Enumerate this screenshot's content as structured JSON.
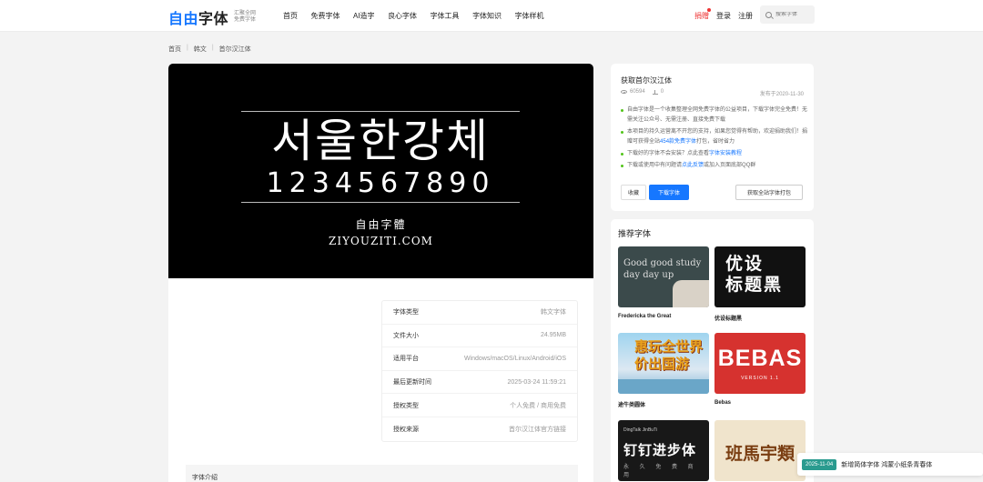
{
  "header": {
    "logo_main_a": "自由",
    "logo_main_b": "字体",
    "logo_sub_1": "汇聚全网",
    "logo_sub_2": "免费字体",
    "nav": [
      "首页",
      "免费字体",
      "AI造字",
      "良心字体",
      "字体工具",
      "字体知识",
      "字体样机"
    ],
    "donate": "捐赠",
    "login": "登录",
    "register": "注册",
    "search_placeholder": "搜索字体"
  },
  "breadcrumb": [
    "首页",
    "韩文",
    "首尔汉江体"
  ],
  "preview": {
    "korean": "서울한강체",
    "numbers": "1234567890",
    "brand_cn": "自由字體",
    "brand_en": "ZIYOUZITI.COM"
  },
  "info_rows": [
    {
      "key": "字体类型",
      "value": "韩文字体"
    },
    {
      "key": "文件大小",
      "value": "24.95MB"
    },
    {
      "key": "适用平台",
      "value": "Windows/macOS/Linux/Android/iOS"
    },
    {
      "key": "最后更新时间",
      "value": "2025-03-24 11:59:21"
    },
    {
      "key": "授权类型",
      "value": "个人免费 / 商用免费"
    },
    {
      "key": "授权来源",
      "value": "首尔汉江体官方链接"
    }
  ],
  "intro_label": "字体介绍",
  "get_card": {
    "title": "获取首尔汉江体",
    "views": "60594",
    "downloads": "0",
    "published": "发布于2020-11-30",
    "tips": [
      {
        "a": "自由字体是一个收集整理全网免费字体的公益项目，下载字体完全免费！无需关注公众号、无需注册、直接免费下载",
        "b": "",
        "c": ""
      },
      {
        "a": "本项目的持久运营离不开您的支持，如果您觉得有帮助，欢迎捐助我们！捐赠可获得全站",
        "b": "454款免费字体",
        "c": "打包，省时省力"
      },
      {
        "a": "下载好的字体不会安装？点此查看",
        "b": "字体安装教程",
        "c": ""
      },
      {
        "a": "下载或使用中有问题请",
        "b": "点此反馈",
        "c": "或加入页面底部QQ群"
      }
    ],
    "btn_fav": "收藏",
    "btn_download": "下载字体",
    "btn_all": "获取全站字体打包"
  },
  "recommend": {
    "title": "推荐字体",
    "items": [
      {
        "name": "Fredericka the Great",
        "thumb_1": "Good good study",
        "thumb_2": "day day up"
      },
      {
        "name": "优设标题黑",
        "thumb_1": "优设",
        "thumb_2": "标题黑"
      },
      {
        "name": "途牛类圆体",
        "thumb_1": "惠玩全世界",
        "thumb_2": "价出国游"
      },
      {
        "name": "Bebas",
        "thumb_1": "BEBAS",
        "thumb_2": "VERSION 1.1"
      },
      {
        "name": "",
        "thumb_1": "DingTalk JinBuTi",
        "thumb_2": "钉钉进步体",
        "thumb_3": "永 久 免 费 商 用"
      },
      {
        "name": "",
        "thumb_1": "班馬宇類"
      }
    ]
  },
  "notice": {
    "date": "2025-11-04",
    "text": "新增简体字体 鸿蒙小纸条青春体"
  }
}
